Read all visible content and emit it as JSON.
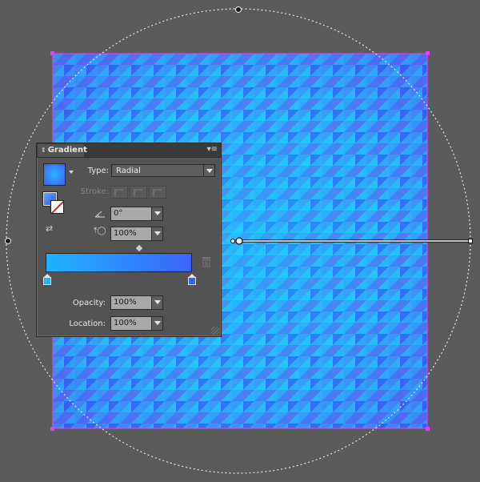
{
  "panel": {
    "title": "Gradient",
    "menu_icon": "panel-menu-icon",
    "type_label": "Type:",
    "type_value": "Radial",
    "stroke_label": "Stroke:",
    "angle_value": "0°",
    "aspect_value": "100%",
    "opacity_label": "Opacity:",
    "opacity_value": "100%",
    "location_label": "Location:",
    "location_value": "100%"
  },
  "gradient_stops": [
    {
      "color": "#1fb4ff"
    },
    {
      "color": "#3b64f6"
    }
  ],
  "colors": {
    "canvas_bg": "#5b5b5b",
    "artwork_light": "#23c2ff",
    "artwork_dark": "#3e5cf5",
    "selection": "#e040ff"
  }
}
